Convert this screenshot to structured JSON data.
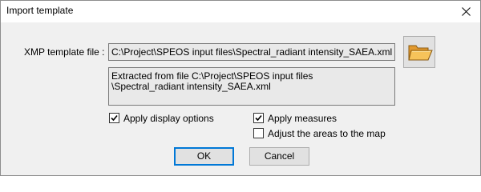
{
  "window": {
    "title": "Import template"
  },
  "form": {
    "xmp_label": "XMP template file :",
    "xmp_path": "C:\\Project\\SPEOS input files\\Spectral_radiant intensity_SAEA.xml",
    "info_line1": "Extracted from file C:\\Project\\SPEOS input files",
    "info_line2": "\\Spectral_radiant intensity_SAEA.xml"
  },
  "options": {
    "apply_display": {
      "label": "Apply display options",
      "checked": true
    },
    "apply_measures": {
      "label": "Apply measures",
      "checked": true
    },
    "adjust_areas": {
      "label": "Adjust the areas to the map",
      "checked": false
    }
  },
  "buttons": {
    "ok": "OK",
    "cancel": "Cancel"
  },
  "icons": {
    "close": "close-icon",
    "folder": "folder-open-icon",
    "check": "checkmark-icon"
  }
}
